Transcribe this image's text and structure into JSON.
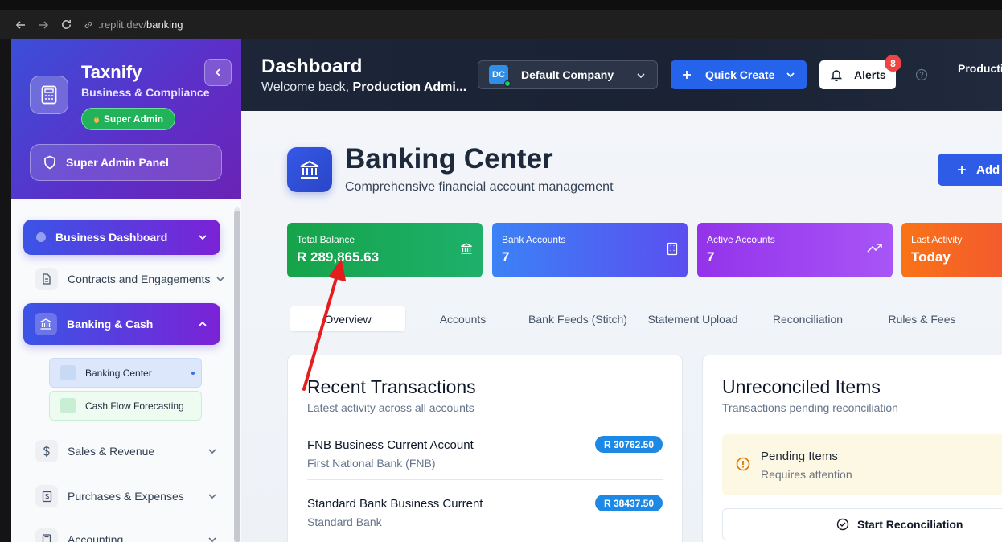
{
  "browser": {
    "url_host": ".replit.dev/",
    "url_path": "banking"
  },
  "sidebar": {
    "brand": "Taxnify",
    "brand_sub": "Business & Compliance",
    "role_badge": "Super Admin",
    "panel_button": "Super Admin Panel",
    "items": [
      {
        "label": "Business Dashboard",
        "icon": "dot-icon"
      },
      {
        "label": "Contracts and Engagements",
        "icon": "document-icon"
      },
      {
        "label": "Banking & Cash",
        "icon": "bank-icon"
      },
      {
        "label": "Banking Center"
      },
      {
        "label": "Cash Flow Forecasting"
      },
      {
        "label": "Sales & Revenue",
        "icon": "dollar-icon"
      },
      {
        "label": "Purchases & Expenses",
        "icon": "receipt-icon"
      },
      {
        "label": "Accounting",
        "icon": "calculator-icon"
      }
    ]
  },
  "header": {
    "title": "Dashboard",
    "welcome_prefix": "Welcome back, ",
    "welcome_name": "Production Admi...",
    "company_initials": "DC",
    "company": "Default Company",
    "quick_create": "Quick Create",
    "alerts": "Alerts",
    "alerts_count": "8",
    "user": "Productio"
  },
  "page": {
    "title": "Banking Center",
    "subtitle": "Comprehensive financial account management",
    "add_button": "Add"
  },
  "stats": [
    {
      "label": "Total Balance",
      "value": "R 289,865.63",
      "color": "#1aae5e"
    },
    {
      "label": "Bank Accounts",
      "value": "7",
      "color": "#4f5ff0"
    },
    {
      "label": "Active Accounts",
      "value": "7",
      "color": "#8a3ff0"
    },
    {
      "label": "Last Activity",
      "value": "Today",
      "color": "#f26a1b"
    }
  ],
  "tabs": [
    "Overview",
    "Accounts",
    "Bank Feeds (Stitch)",
    "Statement Upload",
    "Reconciliation",
    "Rules & Fees"
  ],
  "recent": {
    "title": "Recent Transactions",
    "subtitle": "Latest activity across all accounts",
    "items": [
      {
        "name": "FNB Business Current Account",
        "bank": "First National Bank (FNB)",
        "amount": "R 30762.50"
      },
      {
        "name": "Standard Bank Business Current",
        "bank": "Standard Bank",
        "amount": "R 38437.50"
      }
    ]
  },
  "unreconciled": {
    "title": "Unreconciled Items",
    "subtitle": "Transactions pending reconciliation",
    "pending_title": "Pending Items",
    "pending_sub": "Requires attention",
    "start_button": "Start Reconciliation"
  },
  "annotation": {
    "color": "#e51d1d"
  }
}
